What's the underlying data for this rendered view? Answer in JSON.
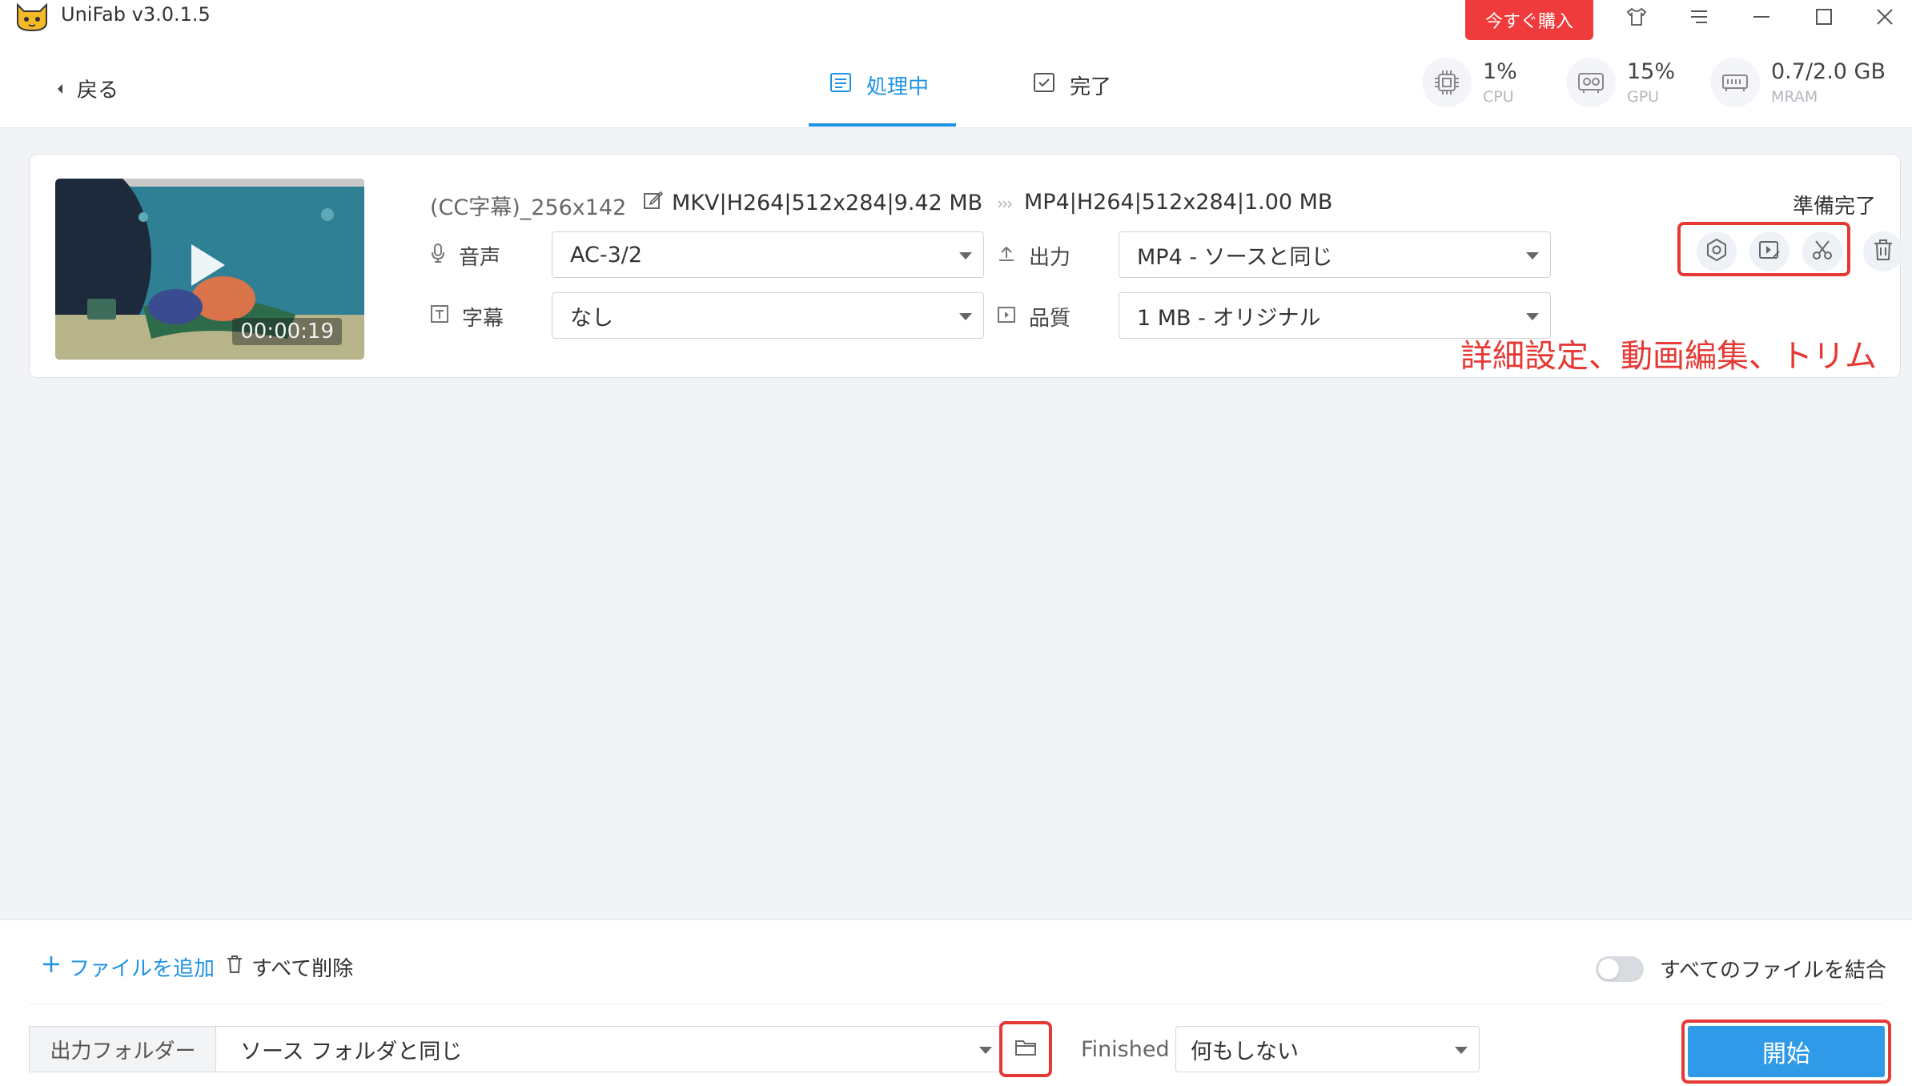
{
  "app": {
    "title": "UniFab v3.0.1.5",
    "buy_label": "今すぐ購入"
  },
  "header": {
    "back_label": "戻る",
    "tabs": [
      {
        "label": "処理中",
        "active": true
      },
      {
        "label": "完了",
        "active": false
      }
    ],
    "stats": [
      {
        "value": "1%",
        "label": "CPU"
      },
      {
        "value": "15%",
        "label": "GPU"
      },
      {
        "value": "0.7/2.0 GB",
        "label": "MRAM"
      }
    ]
  },
  "task": {
    "file_name": "(CC字幕)_256x142",
    "source_info": "MKV|H264|512x284|9.42 MB",
    "output_info": "MP4|H264|512x284|1.00 MB",
    "status": "準備完了",
    "duration": "00:00:19",
    "audio": {
      "label": "音声",
      "value": "AC-3/2"
    },
    "subtitle": {
      "label": "字幕",
      "value": "なし"
    },
    "output": {
      "label": "出力",
      "value": "MP4 - ソースと同じ"
    },
    "quality": {
      "label": "品質",
      "value": "1 MB - オリジナル"
    },
    "annotation": "詳細設定、動画編集、トリム"
  },
  "bottom": {
    "add_file_label": "ファイルを追加",
    "delete_all_label": "すべて削除",
    "merge_label": "すべてのファイルを結合",
    "output_folder_label": "出力フォルダー",
    "output_folder_value": "ソース フォルダと同じ",
    "finished_label": "Finished",
    "finished_value": "何もしない",
    "start_label": "開始"
  },
  "colors": {
    "accent": "#1e93e4",
    "buy": "#ef3b3b",
    "highlight": "#e53935",
    "start": "#2f9be8"
  }
}
